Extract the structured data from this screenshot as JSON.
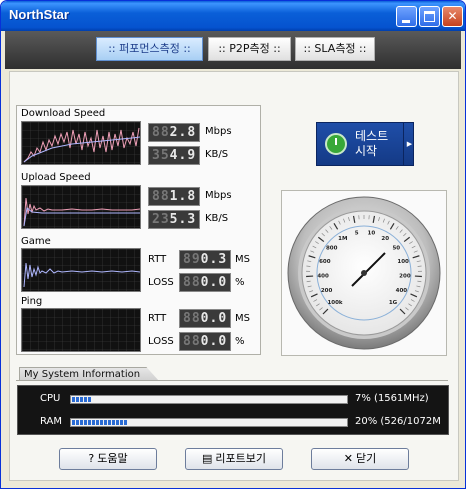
{
  "window": {
    "title": "NorthStar"
  },
  "tabs": [
    {
      "label": ":: 퍼포먼스측정 ::",
      "active": true
    },
    {
      "label": ":: P2P측정 ::",
      "active": false
    },
    {
      "label": ":: SLA측정 ::",
      "active": false
    }
  ],
  "metrics": {
    "download": {
      "label": "Download Speed",
      "mbps": "882.8",
      "mbps_unit": "Mbps",
      "kbs": "354.9",
      "kbs_unit": "KB/S"
    },
    "upload": {
      "label": "Upload Speed",
      "mbps": "881.8",
      "mbps_unit": "Mbps",
      "kbs": "235.3",
      "kbs_unit": "KB/S"
    },
    "game": {
      "label": "Game",
      "rtt_label": "RTT",
      "rtt": "890.3",
      "rtt_unit": "MS",
      "loss_label": "LOSS",
      "loss": "880.0",
      "loss_unit": "%"
    },
    "ping": {
      "label": "Ping",
      "rtt_label": "RTT",
      "rtt": "880.0",
      "rtt_unit": "MS",
      "loss_label": "LOSS",
      "loss": "880.0",
      "loss_unit": "%"
    }
  },
  "start_button": {
    "line1": "테스트",
    "line2": "시작"
  },
  "gauge": {
    "ticks": [
      "100k",
      "200",
      "400",
      "600",
      "800",
      "1M",
      "5",
      "10",
      "20",
      "50",
      "100",
      "200",
      "400",
      "1G"
    ]
  },
  "system_info": {
    "title": "My System Information",
    "cpu_label": "CPU",
    "cpu_value": "7% (1561MHz)",
    "cpu_percent": 7,
    "ram_label": "RAM",
    "ram_value": "20% (526/1072M",
    "ram_percent": 20
  },
  "buttons": {
    "help": "도움말",
    "report": "리포트보기",
    "close": "닫기"
  },
  "colors": {
    "title_bar": "#0a5fd8",
    "accent": "#2b6cd4",
    "start_button": "#1f4ea8"
  }
}
